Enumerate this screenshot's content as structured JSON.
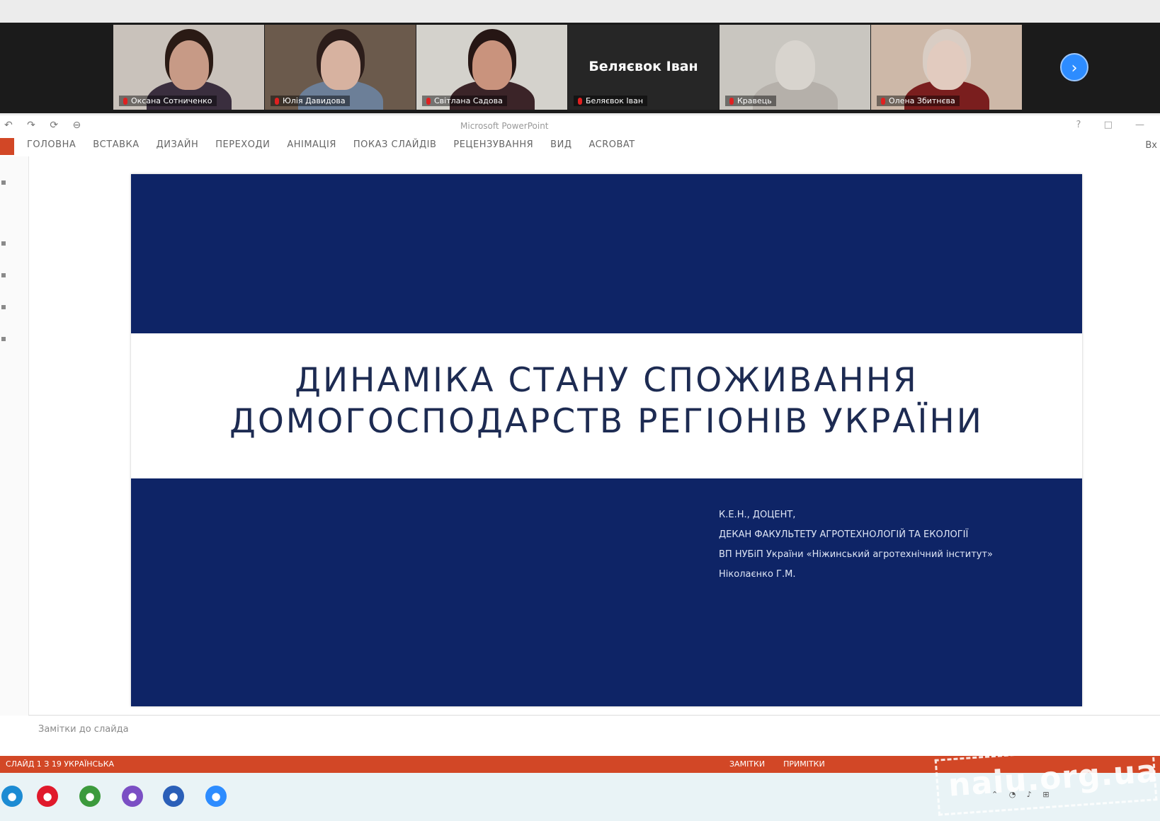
{
  "gallery": {
    "tiles": [
      {
        "name": "Оксана Сотниченко",
        "scene": "#c9c2bb",
        "skin": "#c79a86",
        "hair": "#2a1a14",
        "shirt": "#3a2e3e"
      },
      {
        "name": "Юлія Давидова",
        "scene": "#6b5a4c",
        "skin": "#d7b2a0",
        "hair": "#2c1d1a",
        "shirt": "#6c7f98"
      },
      {
        "name": "Світлана Садова",
        "scene": "#d4d2cc",
        "skin": "#c9937d",
        "hair": "#261614",
        "shirt": "#3b2428"
      },
      {
        "name": "Беляєвок Іван",
        "blank": true
      },
      {
        "name": "Кравець",
        "scene": "#c9c6c0",
        "skin": "#d8d4ce",
        "hair": "#c9c6c0",
        "shirt": "#b5b0aa"
      },
      {
        "name": "Олена Збитнєва",
        "scene": "#cdb8a8",
        "skin": "#e2cbbf",
        "hair": "#d9cdc4",
        "shirt": "#7a1e1e"
      }
    ],
    "next_icon": "chevron-right-icon"
  },
  "window": {
    "title": "Microsoft PowerPoint",
    "ribbon_tabs": [
      "ГОЛОВНА",
      "ВСТАВКА",
      "ДИЗАЙН",
      "ПЕРЕХОДИ",
      "АНІМАЦІЯ",
      "ПОКАЗ СЛАЙДІВ",
      "РЕЦЕНЗУВАННЯ",
      "ВИД",
      "ACROBAT"
    ],
    "user": "Вх"
  },
  "slide": {
    "title_line1": "ДИНАМІКА СТАНУ СПОЖИВАННЯ",
    "title_line2": "ДОМОГОСПОДАРСТВ РЕГІОНІВ УКРАЇНИ",
    "author_lines": [
      "К.Е.Н., ДОЦЕНТ,",
      "ДЕКАН ФАКУЛЬТЕТУ АГРОТЕХНОЛОГІЙ ТА ЕКОЛОГІЇ",
      "ВП НУБіП України «Ніжинський агротехнічний інститут»",
      "Ніколаєнко Г.М."
    ]
  },
  "notes_placeholder": "Замітки до слайда",
  "status": {
    "left": "СЛАЙД 1 З 19   УКРАЇНСЬКА",
    "notes": "ЗАМІТКИ",
    "comments": "ПРИМІТКИ"
  },
  "taskbar": {
    "icons": [
      {
        "name": "edge-icon",
        "color": "#1c8bd3"
      },
      {
        "name": "opera-icon",
        "color": "#e0192b"
      },
      {
        "name": "chrome-icon",
        "color": "#3c9a3c"
      },
      {
        "name": "viber-icon",
        "color": "#7b4fc4"
      },
      {
        "name": "word-icon",
        "color": "#2b5fb8"
      },
      {
        "name": "zoom-icon",
        "color": "#2d8cff"
      }
    ]
  },
  "watermark": "naiu.org.ua"
}
